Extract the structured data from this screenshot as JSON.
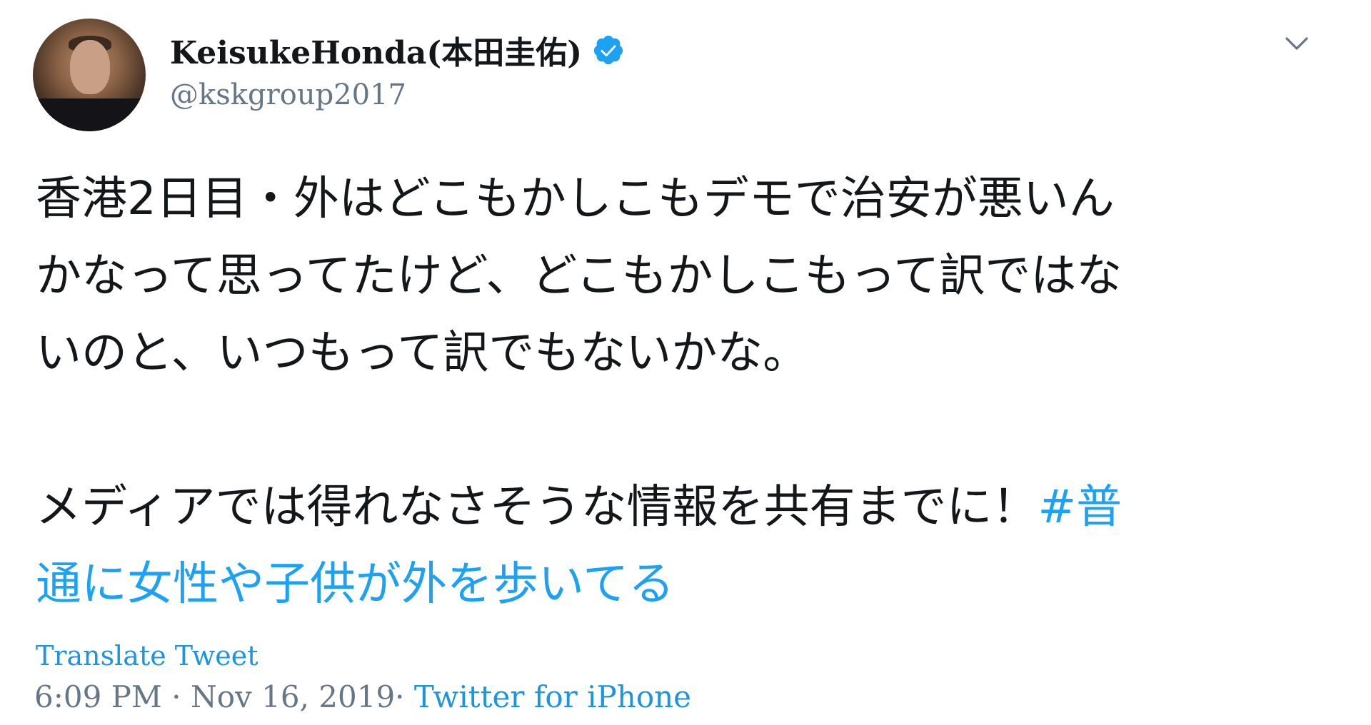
{
  "user": {
    "display_name": "KeisukeHonda(本田圭佑)",
    "handle": "@kskgroup2017",
    "verified": true
  },
  "tweet": {
    "lines": [
      "香港2日目・外はどこもかしこもデモで治安が悪いん",
      "かなって思ってたけど、どこもかしこもって訳ではな",
      "いのと、いつもって訳でもないかな。"
    ],
    "line4_text": "メディアでは得れなさそうな情報を共有までに！",
    "hashtag_part1": "#普",
    "hashtag_part2": "通に女性や子供が外を歩いてる"
  },
  "actions": {
    "translate_label": "Translate Tweet"
  },
  "meta": {
    "time": "6:09 PM",
    "separator": "·",
    "date": "Nov 16, 2019",
    "source": "Twitter for iPhone"
  },
  "colors": {
    "link": "#1da1f2",
    "secondary_text": "#657786",
    "primary_text": "#14171a",
    "verified_badge": "#1da1f2"
  },
  "icons": {
    "verified": "verified-badge-icon",
    "caret": "chevron-down-icon"
  }
}
